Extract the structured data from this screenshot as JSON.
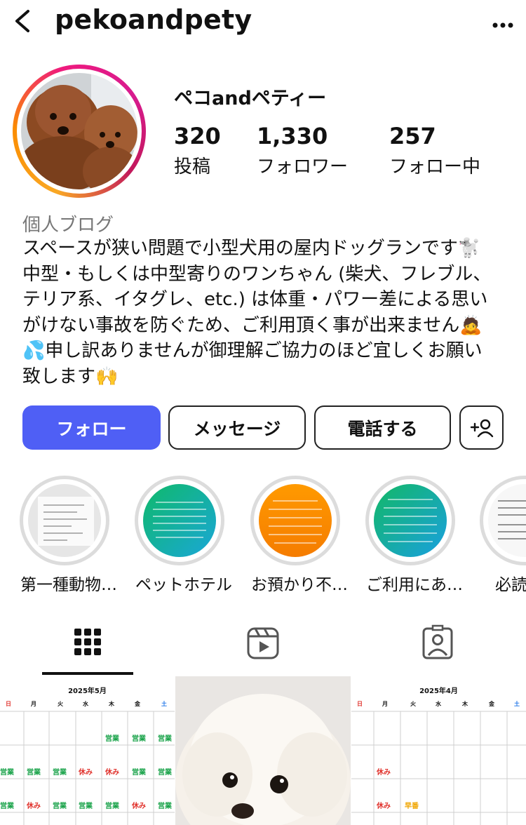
{
  "header": {
    "username": "pekoandpety",
    "back_icon": "chevron-left-icon",
    "more_icon": "more-horizontal-icon"
  },
  "profile": {
    "display_name": "ペコandペティー",
    "stats": [
      {
        "value": "320",
        "label": "投稿"
      },
      {
        "value": "1,330",
        "label": "フォロワー"
      },
      {
        "value": "257",
        "label": "フォロー中"
      }
    ],
    "category": "個人ブログ",
    "bio_lines": [
      "スペースが狭い問題で小型犬用の屋内ドッグランです🐩",
      "中型・もしくは中型寄りのワンちゃん (柴犬、フレブル、",
      "テリア系、イタグレ、etc.) は体重・パワー差による思い",
      "がけない事故を防ぐため、ご利用頂く事が出来ません🙇",
      "💦申し訳ありませんが御理解ご協力のほど宜しくお願い",
      "致します🙌"
    ]
  },
  "actions": {
    "follow": "フォロー",
    "message": "メッセージ",
    "call": "電話する",
    "add_user_icon": "add-user-icon"
  },
  "highlights": [
    {
      "label": "第一種動物…"
    },
    {
      "label": "ペットホテル"
    },
    {
      "label": "お預かり不…"
    },
    {
      "label": "ご利用にあ…"
    },
    {
      "label": "必読"
    }
  ],
  "tabs": [
    {
      "icon": "grid-icon",
      "active": true
    },
    {
      "icon": "reels-icon",
      "active": false
    },
    {
      "icon": "tagged-icon",
      "active": false
    }
  ],
  "posts": [
    {
      "title": "2025年5月"
    },
    {
      "title": ""
    },
    {
      "title": "2025年4月"
    }
  ],
  "colors": {
    "accent": "#4f5ff5",
    "open": "#1aa34a",
    "closed": "#e0312b",
    "early": "#f0a500"
  }
}
